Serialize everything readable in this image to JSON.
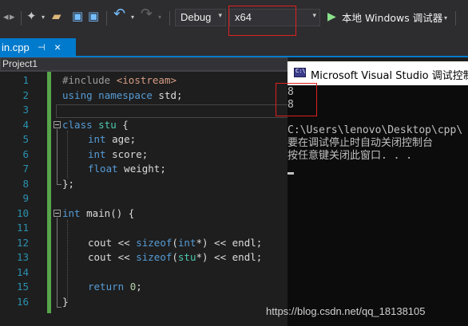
{
  "toolbar": {
    "config_value": "Debug",
    "platform_value": "x64",
    "run_label": "本地 Windows 调试器",
    "dropdown_glyph": "▾"
  },
  "tab": {
    "file_name": "in.cpp",
    "pin_glyph": "⊣",
    "close_glyph": "×"
  },
  "nav": {
    "project": "Project1"
  },
  "editor": {
    "line_numbers": [
      "1",
      "2",
      "3",
      "4",
      "5",
      "6",
      "7",
      "8",
      "9",
      "10",
      "11",
      "12",
      "13",
      "14",
      "15",
      "16"
    ]
  },
  "console": {
    "title": "Microsoft Visual Studio 调试控制台",
    "icon_text": "C:\\",
    "lines": [
      "8",
      "8",
      "",
      "C:\\Users\\lenovo\\Desktop\\cpp\\",
      "要在调试停止时自动关闭控制台",
      "按任意键关闭此窗口. . ."
    ]
  },
  "watermark": "https://blog.csdn.net/qq_18138105",
  "colors": {
    "accent": "#007acc",
    "highlight_box": "#e02020",
    "keyword": "#569cd6",
    "line_number": "#2b91af"
  }
}
